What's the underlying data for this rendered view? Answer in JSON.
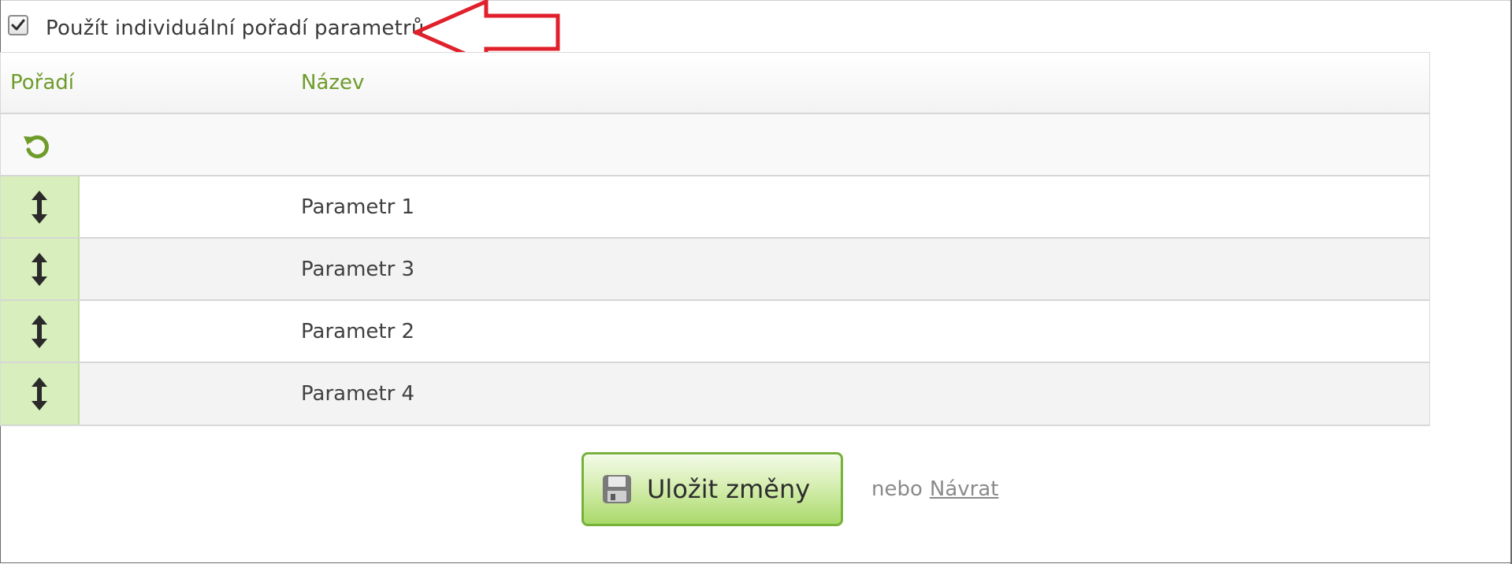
{
  "options": {
    "individual_order_label": "Použít individuální pořadí parametrů",
    "individual_order_checked": true
  },
  "table": {
    "columns": {
      "order": "Pořadí",
      "name": "Název"
    },
    "rows": [
      {
        "name": "Parametr 1"
      },
      {
        "name": "Parametr 3"
      },
      {
        "name": "Parametr 2"
      },
      {
        "name": "Parametr 4"
      }
    ]
  },
  "actions": {
    "save_label": "Uložit změny",
    "or_text": "nebo",
    "back_label": "Návrat"
  },
  "icons": {
    "reset": "refresh-icon",
    "drag": "drag-vertical-arrows-icon",
    "save": "floppy-disk-icon",
    "annotation": "red-outline-arrow"
  },
  "colors": {
    "accent_green": "#6e9c2a",
    "handle_bg": "#d8eebc",
    "annotation_red": "#e0202a"
  }
}
